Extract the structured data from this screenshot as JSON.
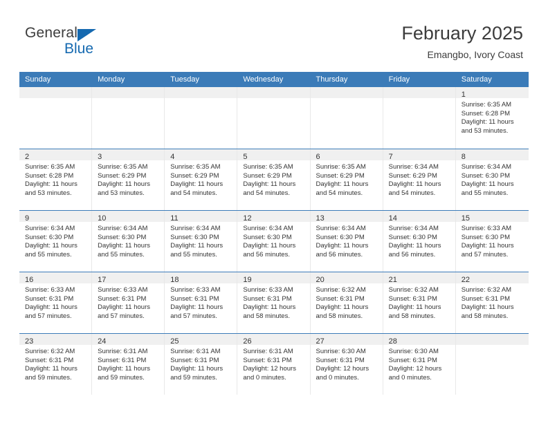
{
  "brand": {
    "name_part1": "General",
    "name_part2": "Blue",
    "triangle_icon": "triangle-icon"
  },
  "header": {
    "title": "February 2025",
    "subtitle": "Emangbo, Ivory Coast"
  },
  "colors": {
    "header_blue": "#3b7bb8",
    "brand_blue": "#1569b0",
    "day_band_gray": "#f0f0f0",
    "text": "#333333",
    "cell_divider": "#e8e8e8"
  },
  "calendar": {
    "weekday_headers": [
      "Sunday",
      "Monday",
      "Tuesday",
      "Wednesday",
      "Thursday",
      "Friday",
      "Saturday"
    ],
    "weeks": [
      [
        {
          "day": "",
          "sunrise": "",
          "sunset": "",
          "daylight_line1": "",
          "daylight_line2": ""
        },
        {
          "day": "",
          "sunrise": "",
          "sunset": "",
          "daylight_line1": "",
          "daylight_line2": ""
        },
        {
          "day": "",
          "sunrise": "",
          "sunset": "",
          "daylight_line1": "",
          "daylight_line2": ""
        },
        {
          "day": "",
          "sunrise": "",
          "sunset": "",
          "daylight_line1": "",
          "daylight_line2": ""
        },
        {
          "day": "",
          "sunrise": "",
          "sunset": "",
          "daylight_line1": "",
          "daylight_line2": ""
        },
        {
          "day": "",
          "sunrise": "",
          "sunset": "",
          "daylight_line1": "",
          "daylight_line2": ""
        },
        {
          "day": "1",
          "sunrise": "Sunrise: 6:35 AM",
          "sunset": "Sunset: 6:28 PM",
          "daylight_line1": "Daylight: 11 hours",
          "daylight_line2": "and 53 minutes."
        }
      ],
      [
        {
          "day": "2",
          "sunrise": "Sunrise: 6:35 AM",
          "sunset": "Sunset: 6:28 PM",
          "daylight_line1": "Daylight: 11 hours",
          "daylight_line2": "and 53 minutes."
        },
        {
          "day": "3",
          "sunrise": "Sunrise: 6:35 AM",
          "sunset": "Sunset: 6:29 PM",
          "daylight_line1": "Daylight: 11 hours",
          "daylight_line2": "and 53 minutes."
        },
        {
          "day": "4",
          "sunrise": "Sunrise: 6:35 AM",
          "sunset": "Sunset: 6:29 PM",
          "daylight_line1": "Daylight: 11 hours",
          "daylight_line2": "and 54 minutes."
        },
        {
          "day": "5",
          "sunrise": "Sunrise: 6:35 AM",
          "sunset": "Sunset: 6:29 PM",
          "daylight_line1": "Daylight: 11 hours",
          "daylight_line2": "and 54 minutes."
        },
        {
          "day": "6",
          "sunrise": "Sunrise: 6:35 AM",
          "sunset": "Sunset: 6:29 PM",
          "daylight_line1": "Daylight: 11 hours",
          "daylight_line2": "and 54 minutes."
        },
        {
          "day": "7",
          "sunrise": "Sunrise: 6:34 AM",
          "sunset": "Sunset: 6:29 PM",
          "daylight_line1": "Daylight: 11 hours",
          "daylight_line2": "and 54 minutes."
        },
        {
          "day": "8",
          "sunrise": "Sunrise: 6:34 AM",
          "sunset": "Sunset: 6:30 PM",
          "daylight_line1": "Daylight: 11 hours",
          "daylight_line2": "and 55 minutes."
        }
      ],
      [
        {
          "day": "9",
          "sunrise": "Sunrise: 6:34 AM",
          "sunset": "Sunset: 6:30 PM",
          "daylight_line1": "Daylight: 11 hours",
          "daylight_line2": "and 55 minutes."
        },
        {
          "day": "10",
          "sunrise": "Sunrise: 6:34 AM",
          "sunset": "Sunset: 6:30 PM",
          "daylight_line1": "Daylight: 11 hours",
          "daylight_line2": "and 55 minutes."
        },
        {
          "day": "11",
          "sunrise": "Sunrise: 6:34 AM",
          "sunset": "Sunset: 6:30 PM",
          "daylight_line1": "Daylight: 11 hours",
          "daylight_line2": "and 55 minutes."
        },
        {
          "day": "12",
          "sunrise": "Sunrise: 6:34 AM",
          "sunset": "Sunset: 6:30 PM",
          "daylight_line1": "Daylight: 11 hours",
          "daylight_line2": "and 56 minutes."
        },
        {
          "day": "13",
          "sunrise": "Sunrise: 6:34 AM",
          "sunset": "Sunset: 6:30 PM",
          "daylight_line1": "Daylight: 11 hours",
          "daylight_line2": "and 56 minutes."
        },
        {
          "day": "14",
          "sunrise": "Sunrise: 6:34 AM",
          "sunset": "Sunset: 6:30 PM",
          "daylight_line1": "Daylight: 11 hours",
          "daylight_line2": "and 56 minutes."
        },
        {
          "day": "15",
          "sunrise": "Sunrise: 6:33 AM",
          "sunset": "Sunset: 6:30 PM",
          "daylight_line1": "Daylight: 11 hours",
          "daylight_line2": "and 57 minutes."
        }
      ],
      [
        {
          "day": "16",
          "sunrise": "Sunrise: 6:33 AM",
          "sunset": "Sunset: 6:31 PM",
          "daylight_line1": "Daylight: 11 hours",
          "daylight_line2": "and 57 minutes."
        },
        {
          "day": "17",
          "sunrise": "Sunrise: 6:33 AM",
          "sunset": "Sunset: 6:31 PM",
          "daylight_line1": "Daylight: 11 hours",
          "daylight_line2": "and 57 minutes."
        },
        {
          "day": "18",
          "sunrise": "Sunrise: 6:33 AM",
          "sunset": "Sunset: 6:31 PM",
          "daylight_line1": "Daylight: 11 hours",
          "daylight_line2": "and 57 minutes."
        },
        {
          "day": "19",
          "sunrise": "Sunrise: 6:33 AM",
          "sunset": "Sunset: 6:31 PM",
          "daylight_line1": "Daylight: 11 hours",
          "daylight_line2": "and 58 minutes."
        },
        {
          "day": "20",
          "sunrise": "Sunrise: 6:32 AM",
          "sunset": "Sunset: 6:31 PM",
          "daylight_line1": "Daylight: 11 hours",
          "daylight_line2": "and 58 minutes."
        },
        {
          "day": "21",
          "sunrise": "Sunrise: 6:32 AM",
          "sunset": "Sunset: 6:31 PM",
          "daylight_line1": "Daylight: 11 hours",
          "daylight_line2": "and 58 minutes."
        },
        {
          "day": "22",
          "sunrise": "Sunrise: 6:32 AM",
          "sunset": "Sunset: 6:31 PM",
          "daylight_line1": "Daylight: 11 hours",
          "daylight_line2": "and 58 minutes."
        }
      ],
      [
        {
          "day": "23",
          "sunrise": "Sunrise: 6:32 AM",
          "sunset": "Sunset: 6:31 PM",
          "daylight_line1": "Daylight: 11 hours",
          "daylight_line2": "and 59 minutes."
        },
        {
          "day": "24",
          "sunrise": "Sunrise: 6:31 AM",
          "sunset": "Sunset: 6:31 PM",
          "daylight_line1": "Daylight: 11 hours",
          "daylight_line2": "and 59 minutes."
        },
        {
          "day": "25",
          "sunrise": "Sunrise: 6:31 AM",
          "sunset": "Sunset: 6:31 PM",
          "daylight_line1": "Daylight: 11 hours",
          "daylight_line2": "and 59 minutes."
        },
        {
          "day": "26",
          "sunrise": "Sunrise: 6:31 AM",
          "sunset": "Sunset: 6:31 PM",
          "daylight_line1": "Daylight: 12 hours",
          "daylight_line2": "and 0 minutes."
        },
        {
          "day": "27",
          "sunrise": "Sunrise: 6:30 AM",
          "sunset": "Sunset: 6:31 PM",
          "daylight_line1": "Daylight: 12 hours",
          "daylight_line2": "and 0 minutes."
        },
        {
          "day": "28",
          "sunrise": "Sunrise: 6:30 AM",
          "sunset": "Sunset: 6:31 PM",
          "daylight_line1": "Daylight: 12 hours",
          "daylight_line2": "and 0 minutes."
        },
        {
          "day": "",
          "sunrise": "",
          "sunset": "",
          "daylight_line1": "",
          "daylight_line2": ""
        }
      ]
    ]
  }
}
